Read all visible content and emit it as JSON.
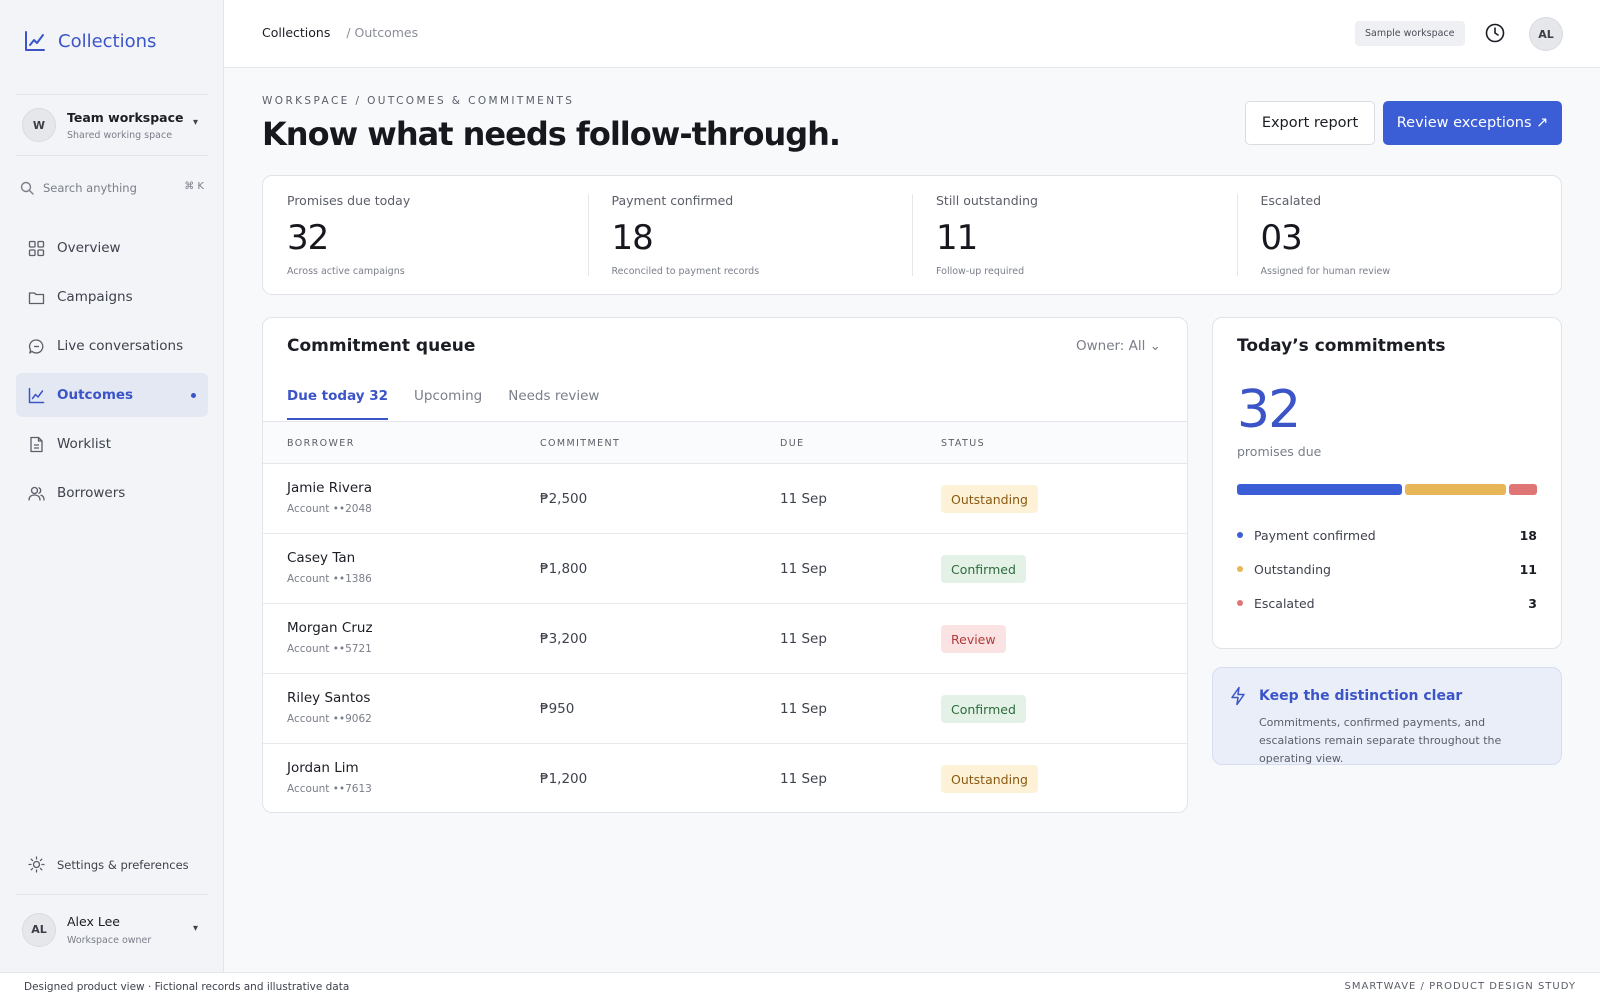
{
  "colors": {
    "accent": "#3b55c8",
    "primary_button": "#3b5dd6",
    "confirmed": "#3b5dd6",
    "outstanding": "#e6b657",
    "escalated": "#e07575",
    "badge_outstanding_bg": "#fdf1d8",
    "badge_outstanding_fg": "#8a5a10",
    "badge_confirmed_bg": "#e3f1e6",
    "badge_confirmed_fg": "#2f6b3d",
    "badge_review_bg": "#fbe3e3",
    "badge_review_fg": "#b13b3b"
  },
  "sidebar": {
    "brand": "Collections",
    "brand_icon": "chart-line-icon",
    "workspace": {
      "initial": "W",
      "name": "Team workspace",
      "subtitle": "Shared working space"
    },
    "search": {
      "placeholder": "Search anything",
      "shortcut": "⌘ K"
    },
    "items": [
      {
        "label": "Overview",
        "icon": "grid-icon",
        "active": false
      },
      {
        "label": "Campaigns",
        "icon": "folder-icon",
        "active": false
      },
      {
        "label": "Live conversations",
        "icon": "chat-icon",
        "active": false
      },
      {
        "label": "Outcomes",
        "icon": "chart-line-icon",
        "active": true
      },
      {
        "label": "Worklist",
        "icon": "document-icon",
        "active": false
      },
      {
        "label": "Borrowers",
        "icon": "users-icon",
        "active": false
      }
    ],
    "settings_label": "Settings & preferences",
    "user": {
      "initials": "AL",
      "name": "Alex Lee",
      "role": "Workspace owner"
    }
  },
  "topbar": {
    "crumb_root": "Collections",
    "crumb_current": "/ Outcomes",
    "workspace_badge": "Sample workspace",
    "avatar_initials": "AL"
  },
  "header": {
    "eyebrow": "WORKSPACE / OUTCOMES & COMMITMENTS",
    "title": "Know what needs follow-through.",
    "export_label": "Export report",
    "review_label": "Review exceptions ↗"
  },
  "stats": [
    {
      "label": "Promises due today",
      "value": "32",
      "note": "Across active campaigns"
    },
    {
      "label": "Payment confirmed",
      "value": "18",
      "note": "Reconciled to payment records"
    },
    {
      "label": "Still outstanding",
      "value": "11",
      "note": "Follow-up required"
    },
    {
      "label": "Escalated",
      "value": "03",
      "note": "Assigned for human review"
    }
  ],
  "queue": {
    "title": "Commitment queue",
    "owner_filter": "Owner: All ⌄",
    "tabs": [
      "Due today 32",
      "Upcoming",
      "Needs review"
    ],
    "columns": [
      "BORROWER",
      "COMMITMENT",
      "DUE",
      "STATUS"
    ],
    "rows": [
      {
        "name": "Jamie Rivera",
        "account": "Account ••2048",
        "amount": "₱2,500",
        "due": "11 Sep",
        "status": "Outstanding"
      },
      {
        "name": "Casey Tan",
        "account": "Account ••1386",
        "amount": "₱1,800",
        "due": "11 Sep",
        "status": "Confirmed"
      },
      {
        "name": "Morgan Cruz",
        "account": "Account ••5721",
        "amount": "₱3,200",
        "due": "11 Sep",
        "status": "Review"
      },
      {
        "name": "Riley Santos",
        "account": "Account ••9062",
        "amount": "₱950",
        "due": "11 Sep",
        "status": "Confirmed"
      },
      {
        "name": "Jordan Lim",
        "account": "Account ••7613",
        "amount": "₱1,200",
        "due": "11 Sep",
        "status": "Outstanding"
      }
    ]
  },
  "today": {
    "title": "Today’s commitments",
    "total": "32",
    "subtitle": "promises due",
    "breakdown": [
      {
        "label": "Payment confirmed",
        "value": 18,
        "color": "#3b5dd6"
      },
      {
        "label": "Outstanding",
        "value": 11,
        "color": "#e6b657"
      },
      {
        "label": "Escalated",
        "value": 3,
        "color": "#e07575"
      }
    ]
  },
  "tip": {
    "icon": "lightning-icon",
    "title": "Keep the distinction clear",
    "body": "Commitments, confirmed payments, and escalations remain separate throughout the operating view."
  },
  "footer": {
    "left": "Designed product view · Fictional records and illustrative data",
    "right": "SMARTWAVE / PRODUCT DESIGN STUDY"
  }
}
